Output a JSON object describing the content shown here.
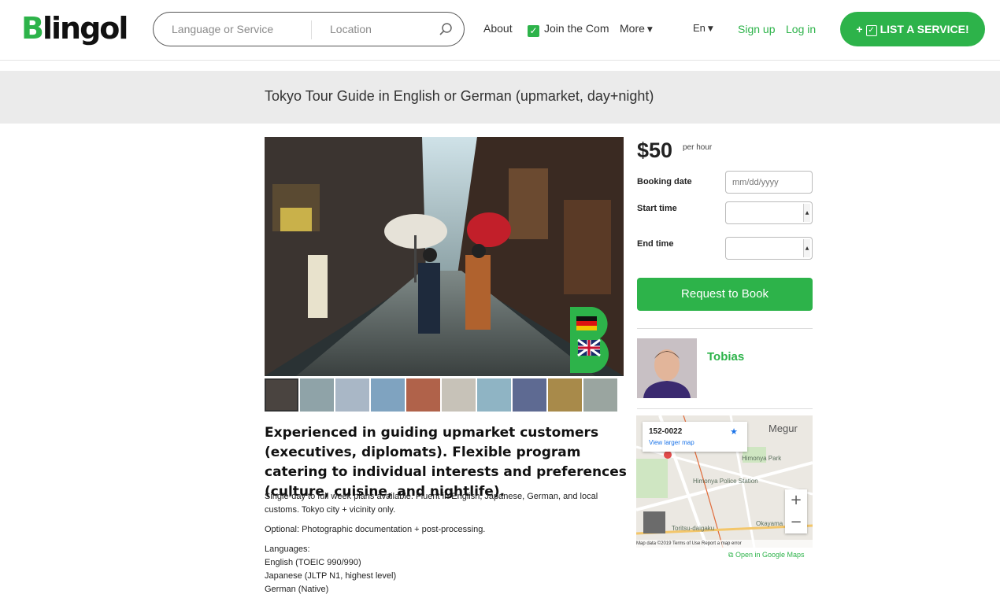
{
  "header": {
    "logo": "Blingol",
    "search": {
      "service_placeholder": "Language or Service",
      "location_placeholder": "Location"
    },
    "nav": {
      "about": "About",
      "join": "Join the Community",
      "more": "More",
      "language": "En",
      "signup": "Sign up",
      "login": "Log in"
    },
    "list_button": "LIST A SERVICE!"
  },
  "listing": {
    "title": "Tokyo Tour Guide in English or German (upmarket, day+night)",
    "headline": "Experienced in guiding upmarket customers (executives, diplomats). Flexible program catering to individual interests and preferences (culture, cuisine, and nightlife).",
    "description": "Single-day to full week plans available. Fluent in English, Japanese, German, and local customs. Tokyo city + vicinity only.",
    "optional": "Optional: Photographic documentation + post-processing.",
    "languages_label": "Languages:",
    "languages": [
      "English (TOEIC 990/990)",
      "Japanese (JLTP N1, highest level)",
      "German (Native)"
    ],
    "thumbnail_count": 10
  },
  "booking": {
    "price": "$50",
    "per": "per hour",
    "booking_date_label": "Booking date",
    "date_placeholder": "mm/dd/yyyy",
    "start_time_label": "Start time",
    "end_time_label": "End time",
    "request_button": "Request to Book"
  },
  "host": {
    "name": "Tobias"
  },
  "map": {
    "zip": "152-0022",
    "view_larger": "View larger map",
    "labels": [
      "Himonya Park",
      "Himonya Police Station",
      "Toritsu-daigaku",
      "Okayama",
      "Megur"
    ],
    "footer": "Map data ©2019   Terms of Use   Report a map error",
    "open_link": "Open in Google Maps"
  },
  "colors": {
    "brand_green": "#2db34a"
  }
}
